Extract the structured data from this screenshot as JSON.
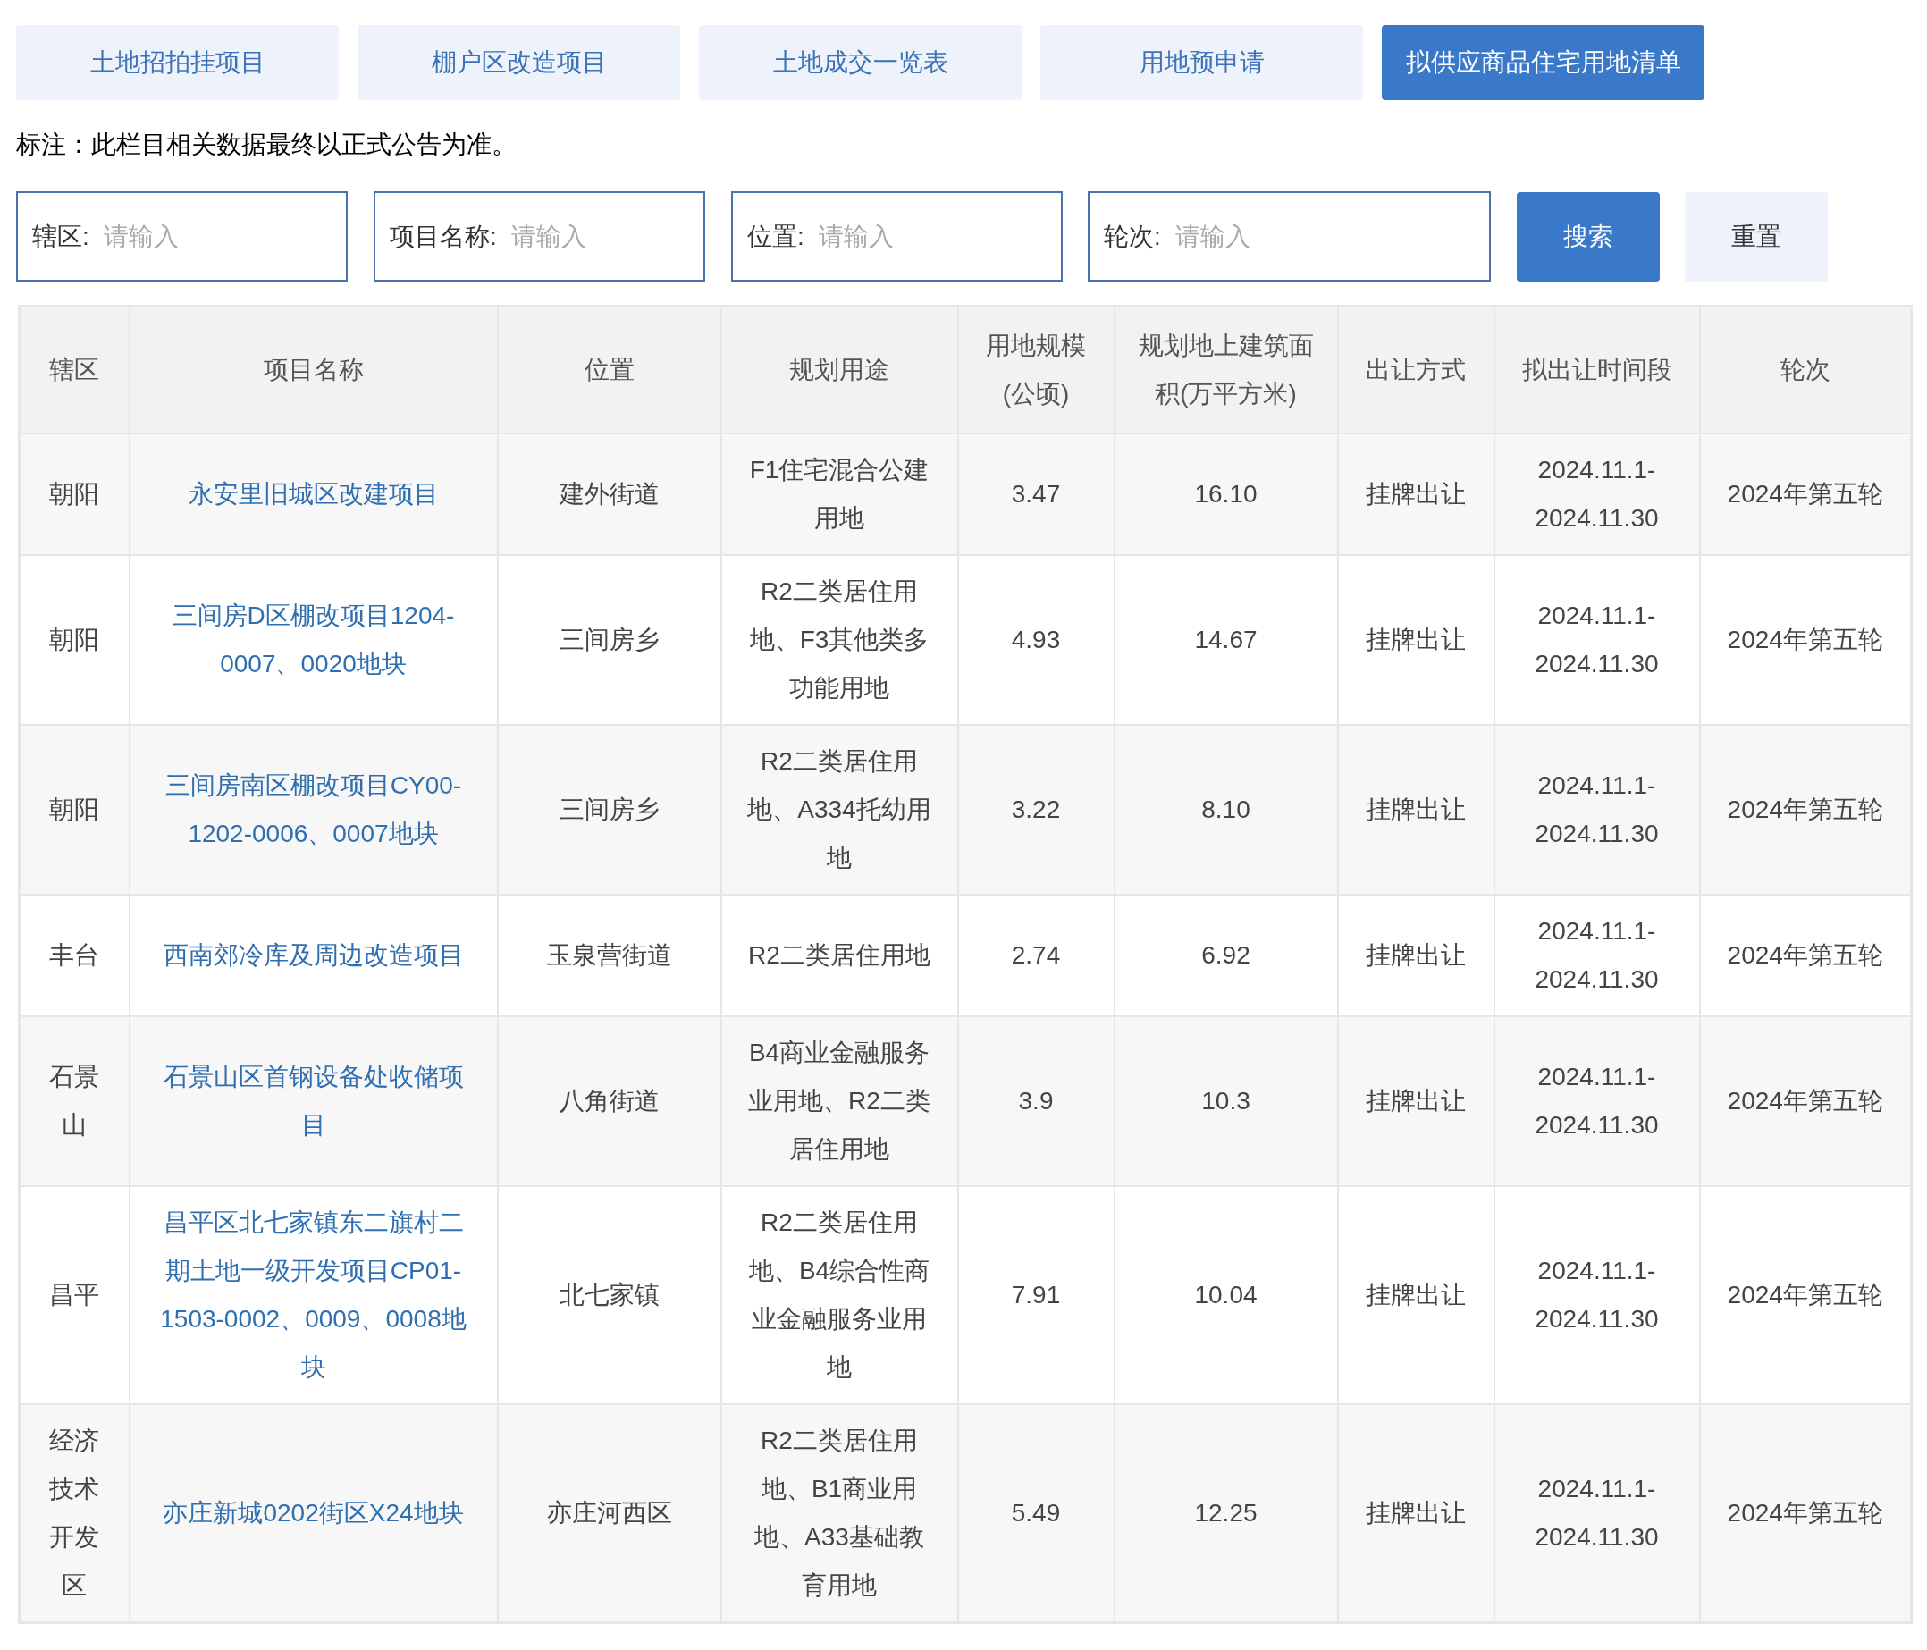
{
  "tabs": [
    {
      "label": "土地招拍挂项目",
      "selected": false
    },
    {
      "label": "棚户区改造项目",
      "selected": false
    },
    {
      "label": "土地成交一览表",
      "selected": false
    },
    {
      "label": "用地预申请",
      "selected": false
    },
    {
      "label": "拟供应商品住宅用地清单",
      "selected": true
    }
  ],
  "note": "标注：此栏目相关数据最终以正式公告为准。",
  "filters": [
    {
      "label": "辖区:",
      "placeholder": "请输入"
    },
    {
      "label": "项目名称:",
      "placeholder": "请输入"
    },
    {
      "label": "位置:",
      "placeholder": "请输入"
    },
    {
      "label": "轮次:",
      "placeholder": "请输入"
    }
  ],
  "buttons": [
    {
      "label": "搜索",
      "kind": "primary"
    },
    {
      "label": "重置",
      "kind": "secondary"
    }
  ],
  "table": {
    "columns": [
      "辖区",
      "项目名称",
      "位置",
      "规划用途",
      "用地规模(公顷)",
      "规划地上建筑面积(万平方米)",
      "出让方式",
      "拟出让时间段",
      "轮次"
    ],
    "rows": [
      {
        "district": "朝阳",
        "project": "永安里旧城区改建项目",
        "location": "建外街道",
        "use": "F1住宅混合公建用地",
        "area": "3.47",
        "floor_area": "16.10",
        "method": "挂牌出让",
        "period": "2024.11.1-2024.11.30",
        "round": "2024年第五轮"
      },
      {
        "district": "朝阳",
        "project": "三间房D区棚改项目1204-0007、0020地块",
        "location": "三间房乡",
        "use": "R2二类居住用地、F3其他类多功能用地",
        "area": "4.93",
        "floor_area": "14.67",
        "method": "挂牌出让",
        "period": "2024.11.1-2024.11.30",
        "round": "2024年第五轮"
      },
      {
        "district": "朝阳",
        "project": "三间房南区棚改项目CY00-1202-0006、0007地块",
        "location": "三间房乡",
        "use": "R2二类居住用地、A334托幼用地",
        "area": "3.22",
        "floor_area": "8.10",
        "method": "挂牌出让",
        "period": "2024.11.1-2024.11.30",
        "round": "2024年第五轮"
      },
      {
        "district": "丰台",
        "project": "西南郊冷库及周边改造项目",
        "location": "玉泉营街道",
        "use": "R2二类居住用地",
        "area": "2.74",
        "floor_area": "6.92",
        "method": "挂牌出让",
        "period": "2024.11.1-2024.11.30",
        "round": "2024年第五轮"
      },
      {
        "district": "石景山",
        "project": "石景山区首钢设备处收储项目",
        "location": "八角街道",
        "use": "B4商业金融服务业用地、R2二类居住用地",
        "area": "3.9",
        "floor_area": "10.3",
        "method": "挂牌出让",
        "period": "2024.11.1-2024.11.30",
        "round": "2024年第五轮"
      },
      {
        "district": "昌平",
        "project": "昌平区北七家镇东二旗村二期土地一级开发项目CP01-1503-0002、0009、0008地块",
        "location": "北七家镇",
        "use": "R2二类居住用地、B4综合性商业金融服务业用地",
        "area": "7.91",
        "floor_area": "10.04",
        "method": "挂牌出让",
        "period": "2024.11.1-2024.11.30",
        "round": "2024年第五轮"
      },
      {
        "district": "经济技术开发区",
        "project": "亦庄新城0202街区X24地块",
        "location": "亦庄河西区",
        "use": "R2二类居住用地、B1商业用地、A33基础教育用地",
        "area": "5.49",
        "floor_area": "12.25",
        "method": "挂牌出让",
        "period": "2024.11.1-2024.11.30",
        "round": "2024年第五轮"
      }
    ]
  }
}
